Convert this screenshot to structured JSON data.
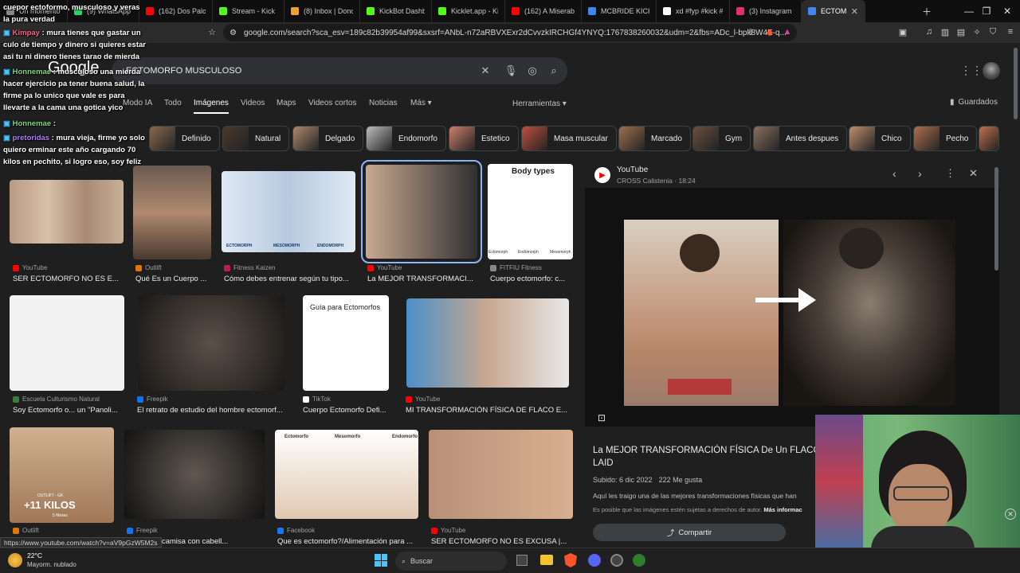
{
  "browser": {
    "tabs": [
      {
        "label": "Un momento...",
        "color": "#888888"
      },
      {
        "label": "(9) WhatsApp",
        "color": "#25d366"
      },
      {
        "label": "(162) Dos Palo",
        "color": "#ff0000"
      },
      {
        "label": "Stream - Kick",
        "color": "#53fc18"
      },
      {
        "label": "(8) Inbox | Donoc",
        "color": "#f0a030"
      },
      {
        "label": "KickBot Dashboa",
        "color": "#53fc18"
      },
      {
        "label": "Kicklet.app - Kick",
        "color": "#53fc18"
      },
      {
        "label": "(162) A Miserable",
        "color": "#ff0000"
      },
      {
        "label": "MCBRIDE KICK - ",
        "color": "#4285f4"
      },
      {
        "label": "xd #fyp #kick #m",
        "color": "#ffffff"
      },
      {
        "label": "(3) Instagram",
        "color": "#e1306c"
      },
      {
        "label": "ECTOMORFO",
        "color": "#4285f4",
        "active": true
      }
    ],
    "url": "google.com/search?sca_esv=189c82b39954af99&sxsrf=ANbL-n72aRBVXExr2dCvvzkIRCHGf4YNYQ:1767838260032&udm=2&fbs=ADc_l-bpk8W4E-q...",
    "status_url": "https://www.youtube.com/watch?v=aV9pGzW5M2s"
  },
  "search": {
    "logo": "Google",
    "query": "ECTOMORFO MUSCULOSO",
    "tabs": [
      "Modo IA",
      "Todo",
      "Imágenes",
      "Videos",
      "Maps",
      "Videos cortos",
      "Noticias",
      "Más"
    ],
    "active_tab": "Imágenes",
    "tools": "Herramientas",
    "saved": "Guardados",
    "chips": [
      "Definido",
      "Natural",
      "Delgado",
      "Endomorfo",
      "Estetico",
      "Masa muscular",
      "Marcado",
      "Gym",
      "Antes despues",
      "Chico",
      "Pecho"
    ]
  },
  "results": [
    {
      "source": "YouTube",
      "caption": "SER ECTOMORFO NO ES E...",
      "src_color": "#ff0000"
    },
    {
      "source": "Outlift",
      "caption": "Qué Es un Cuerpo ...",
      "src_color": "#e37400"
    },
    {
      "source": "Fitness Kaizen",
      "caption": "Cómo debes entrenar según tu tipo...",
      "src_color": "#c2185b"
    },
    {
      "source": "YouTube",
      "caption": "La MEJOR TRANSFORMACI...",
      "src_color": "#ff0000"
    },
    {
      "source": "FITFIU Fitness",
      "caption": "Cuerpo ectomorfo: c...",
      "src_color": "#888888"
    },
    {
      "source": "Escuela Culturismo Natural",
      "caption": "Soy Ectomorfo o... un \"Panoli...",
      "src_color": "#3b7d3b"
    },
    {
      "source": "Freepik",
      "caption": "El retrato de estudio del hombre ectomorf...",
      "src_color": "#1273eb"
    },
    {
      "source": "TikTok",
      "caption": "Cuerpo Ectomorfo Defi...",
      "src_color": "#ffffff"
    },
    {
      "source": "YouTube",
      "caption": "MI TRANSFORMACIÓN FÍSICA DE FLACO E...",
      "src_color": "#ff0000"
    },
    {
      "source": "Outlift",
      "caption": "",
      "src_color": "#e37400"
    },
    {
      "source": "Freepik",
      "caption": "guapo sin camisa con cabell...",
      "src_color": "#1273eb"
    },
    {
      "source": "Facebook",
      "caption": "Que es ectomorfo?/Alimentación para ...",
      "src_color": "#1877f2"
    },
    {
      "source": "YouTube",
      "caption": "SER ECTOMORFO NO ES EXCUSA |...",
      "src_color": "#ff0000"
    }
  ],
  "image_text": {
    "body_types": "Body types",
    "ecto": "Ectomorph",
    "endo": "Endomorph",
    "meso": "Mesomorph",
    "guia": "Guía para Ectomorfos",
    "endo_label": "ENDOMORPH",
    "meso_label": "MESOMORPH",
    "ecto_label": "ECTOMORPH",
    "ectomorfo": "Ectomorfo",
    "mesomorfo": "Mesomorfo",
    "endomorfo": "Endomorfo",
    "kilos": "+11 KILOS",
    "outlift_gk": "OUTLIFT - GK",
    "meses": "5 Meses"
  },
  "chat": [
    {
      "user": "",
      "text": "cuepor ectoformo, musculoso y veras la pura verdad"
    },
    {
      "user": "Kimpay",
      "text": "mura tienes que gastar un culo de tiempo y dinero si quieres estar asi tu ni dinero tienes tarao de mierda"
    },
    {
      "user": "Honnemae",
      "text": "musculoso una mierda hacer ejercicio pa tener buena salud, la firme pa lo unico que vale es para llevarte a la cama una gotica yico"
    },
    {
      "user": "Honnemae",
      "text": ""
    },
    {
      "user": "pretoridas",
      "text": "mura vieja, firme yo solo quiero erminar este año cargando 70 kilos en pechito, si logro eso, soy feliz"
    }
  ],
  "panel": {
    "source": "YouTube",
    "channel": "CROSS Calistenia · 18:24",
    "title": "La MEJOR TRANSFORMACIÓN FÍSICA De Un FLACO LAID",
    "uploaded": "Subido: 6 dic 2022",
    "likes": "222 Me gusta",
    "desc": "Aquí les traigo una de las mejores transformaciones físicas que han",
    "copyright": "Es posible que las imágenes estén sujetas a derechos de autor.",
    "more": "Más informac",
    "share": "Compartir"
  },
  "taskbar": {
    "weather_temp": "22°C",
    "weather_desc": "Mayorm. nublado",
    "search": "Buscar"
  }
}
